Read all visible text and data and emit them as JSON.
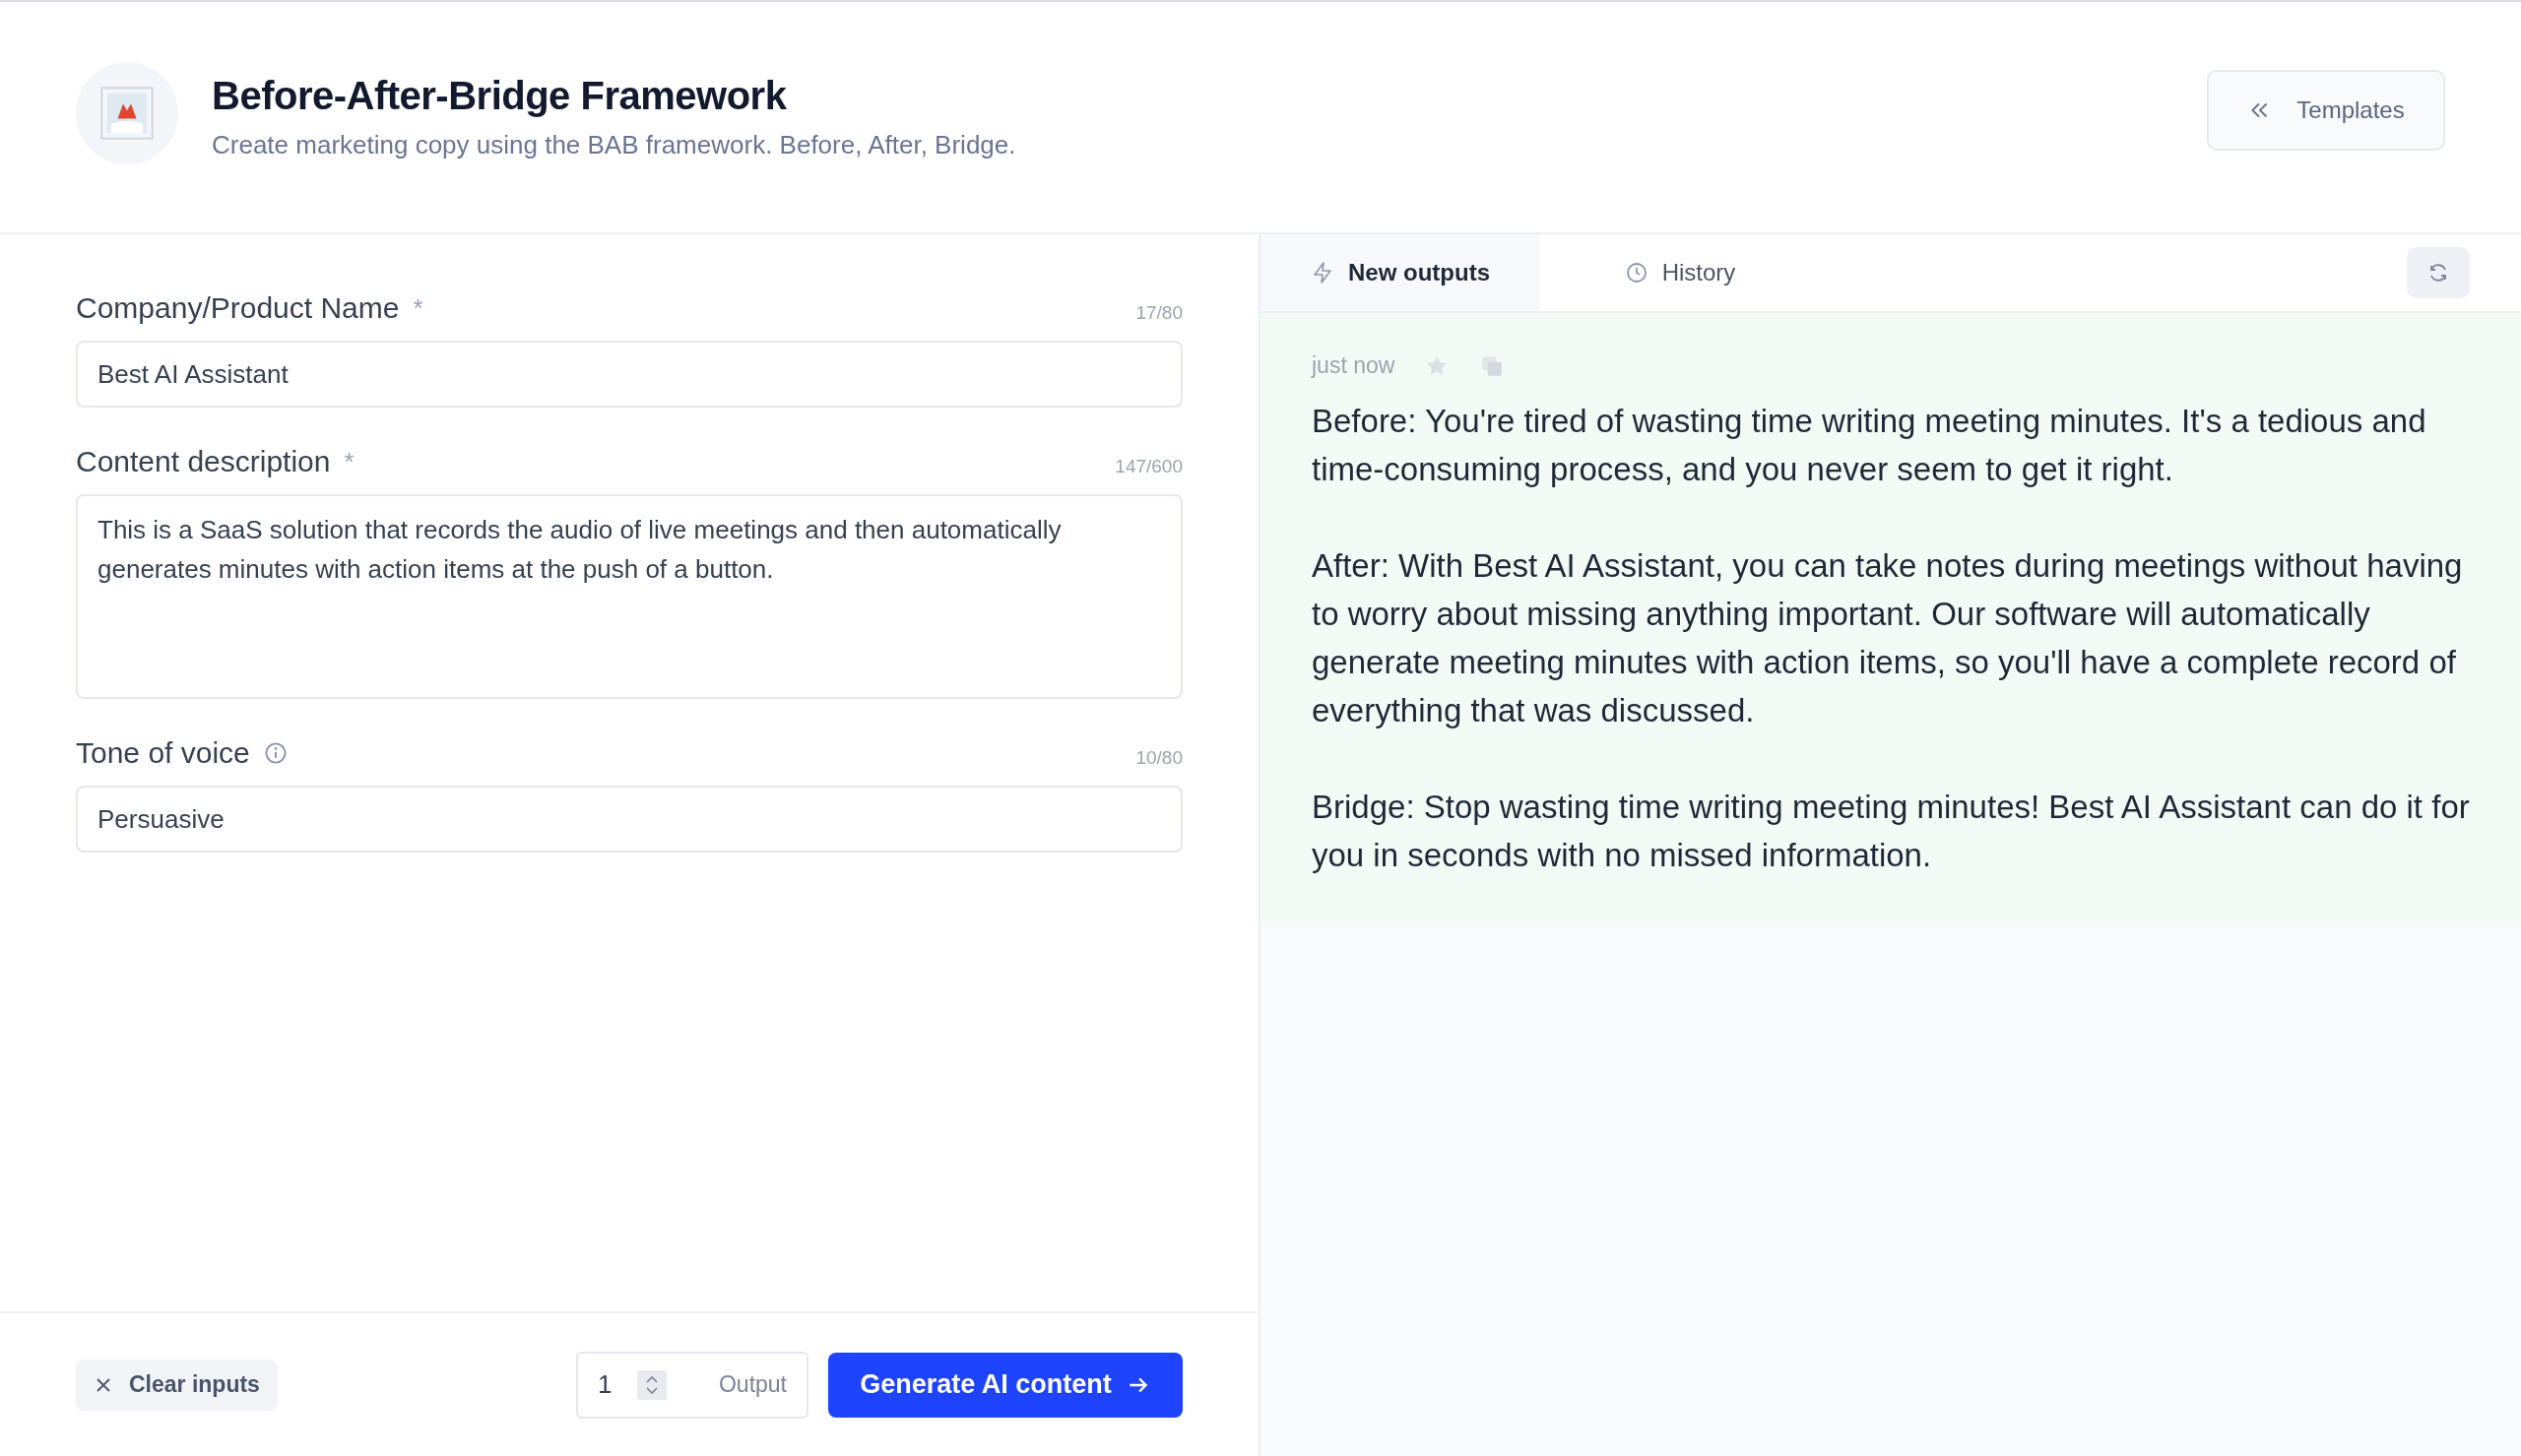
{
  "header": {
    "title": "Before-After-Bridge Framework",
    "subtitle": "Create marketing copy using the BAB framework. Before, After, Bridge."
  },
  "templates_button": {
    "label": "Templates"
  },
  "form": {
    "fields": [
      {
        "kind": "input",
        "label": "Company/Product Name",
        "required_mark": "*",
        "info": false,
        "counter": "17/80",
        "value": "Best AI Assistant"
      },
      {
        "kind": "textarea",
        "label": "Content description",
        "required_mark": "*",
        "info": false,
        "counter": "147/600",
        "value": "This is a SaaS solution that records the audio of live meetings and then automatically generates minutes with action items at the push of a button."
      },
      {
        "kind": "input",
        "label": "Tone of voice",
        "info": true,
        "counter": "10/80",
        "value": "Persuasive"
      }
    ]
  },
  "footer": {
    "clear_button": "Clear inputs",
    "output_count": "1",
    "output_label": "Output",
    "generate_button": "Generate AI content"
  },
  "output_panel": {
    "tabs": [
      {
        "label": "New outputs",
        "kind": "new",
        "selected": true
      },
      {
        "label": "History",
        "kind": "history",
        "selected": false
      }
    ],
    "result": {
      "time": "just now",
      "paragraphs": [
        "Before: You're tired of wasting time writing meeting minutes. It's a tedious and time-consuming process, and you never seem to get it right.",
        "After: With Best AI Assistant, you can take notes during meetings without having to worry about missing anything important. Our software will automatically generate meeting minutes with action items, so you'll have a complete record of everything that was discussed.",
        "Bridge: Stop wasting time writing meeting minutes! Best AI Assistant can do it for you in seconds with no missed information."
      ]
    }
  }
}
